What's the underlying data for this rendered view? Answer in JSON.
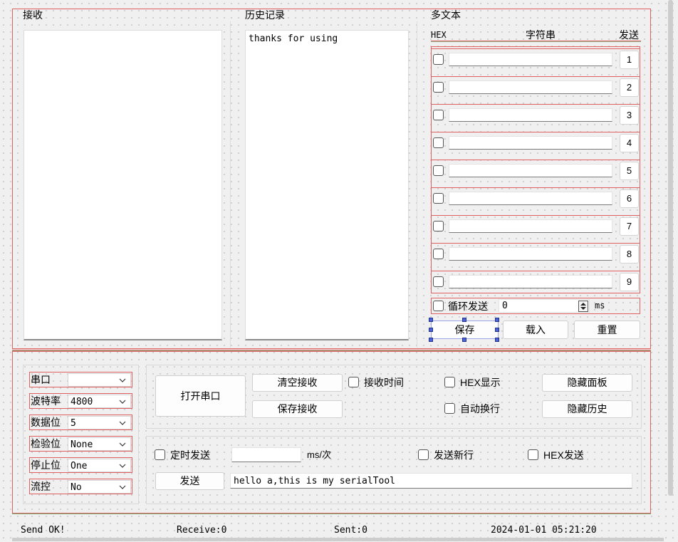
{
  "panels": {
    "receive_title": "接收",
    "history_title": "历史记录",
    "history_text": "thanks for using",
    "multitext_title": "多文本"
  },
  "multitext": {
    "col_hex": "HEX",
    "col_string": "字符串",
    "col_send": "发送",
    "rows": [
      "1",
      "2",
      "3",
      "4",
      "5",
      "6",
      "7",
      "8",
      "9"
    ],
    "loop_label": "循环发送",
    "loop_value": "0",
    "loop_unit": "ms",
    "save_button": "保存",
    "load_button": "载入",
    "reset_button": "重置"
  },
  "serial_settings": {
    "port_label": "串口",
    "port_value": "",
    "baud_label": "波特率",
    "baud_value": "4800",
    "databits_label": "数据位",
    "databits_value": "5",
    "parity_label": "检验位",
    "parity_value": "None",
    "stopbits_label": "停止位",
    "stopbits_value": "One",
    "flow_label": "流控",
    "flow_value": "No"
  },
  "controls": {
    "open_port_button": "打开串口",
    "clear_receive_button": "清空接收",
    "save_receive_button": "保存接收",
    "receive_time_label": "接收时间",
    "hex_display_label": "HEX显示",
    "auto_wrap_label": "自动换行",
    "hide_panel_button": "隐藏面板",
    "hide_history_button": "隐藏历史"
  },
  "send": {
    "timed_send_label": "定时发送",
    "interval_value": "",
    "interval_unit": "ms/次",
    "send_newline_label": "发送新行",
    "hex_send_label": "HEX发送",
    "send_button": "发送",
    "send_text": "hello a,this is my serialTool"
  },
  "status": {
    "message": "Send OK!",
    "receive": "Receive:0",
    "sent": "Sent:0",
    "datetime": "2024-01-01 05:21:20"
  },
  "icons": {
    "checkbox": "checkbox-unchecked",
    "dropdown": "chevron-down-icon",
    "spin": "spin-up-down-icon"
  }
}
